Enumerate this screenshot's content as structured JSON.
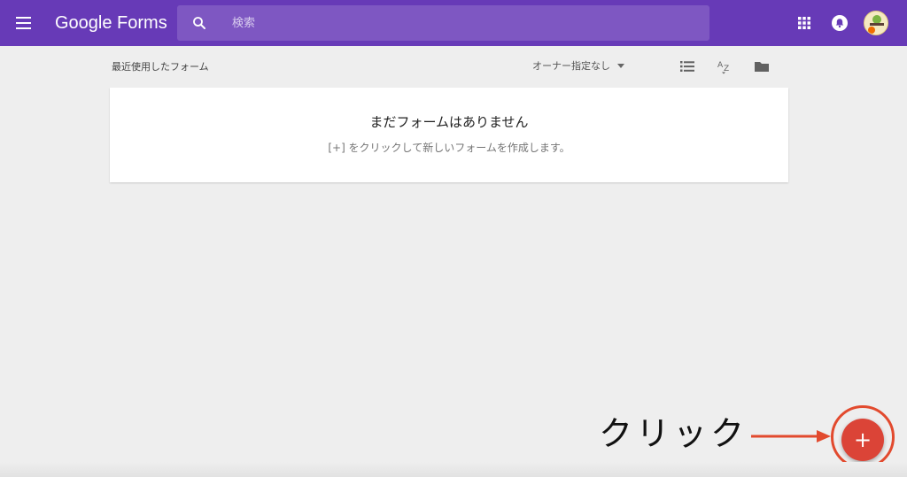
{
  "header": {
    "logo": "Google Forms",
    "search_placeholder": "検索",
    "icons": [
      "menu-icon",
      "search-icon",
      "apps-grid-icon",
      "notifications-bell-icon",
      "avatar"
    ]
  },
  "toolbar": {
    "section_title": "最近使用したフォーム",
    "owner_filter": "オーナー指定なし",
    "icons": [
      "list-view-icon",
      "sort-az-icon",
      "folder-icon"
    ]
  },
  "empty_state": {
    "title": "まだフォームはありません",
    "hint": "[+] をクリックして新しいフォームを作成します。"
  },
  "annotation": {
    "text": "クリック",
    "color": "#e24a2e"
  },
  "fab": {
    "label": "+",
    "color": "#db4437"
  },
  "colors": {
    "header": "#673ab7",
    "search": "#7e57c2",
    "background": "#eeeeee"
  }
}
